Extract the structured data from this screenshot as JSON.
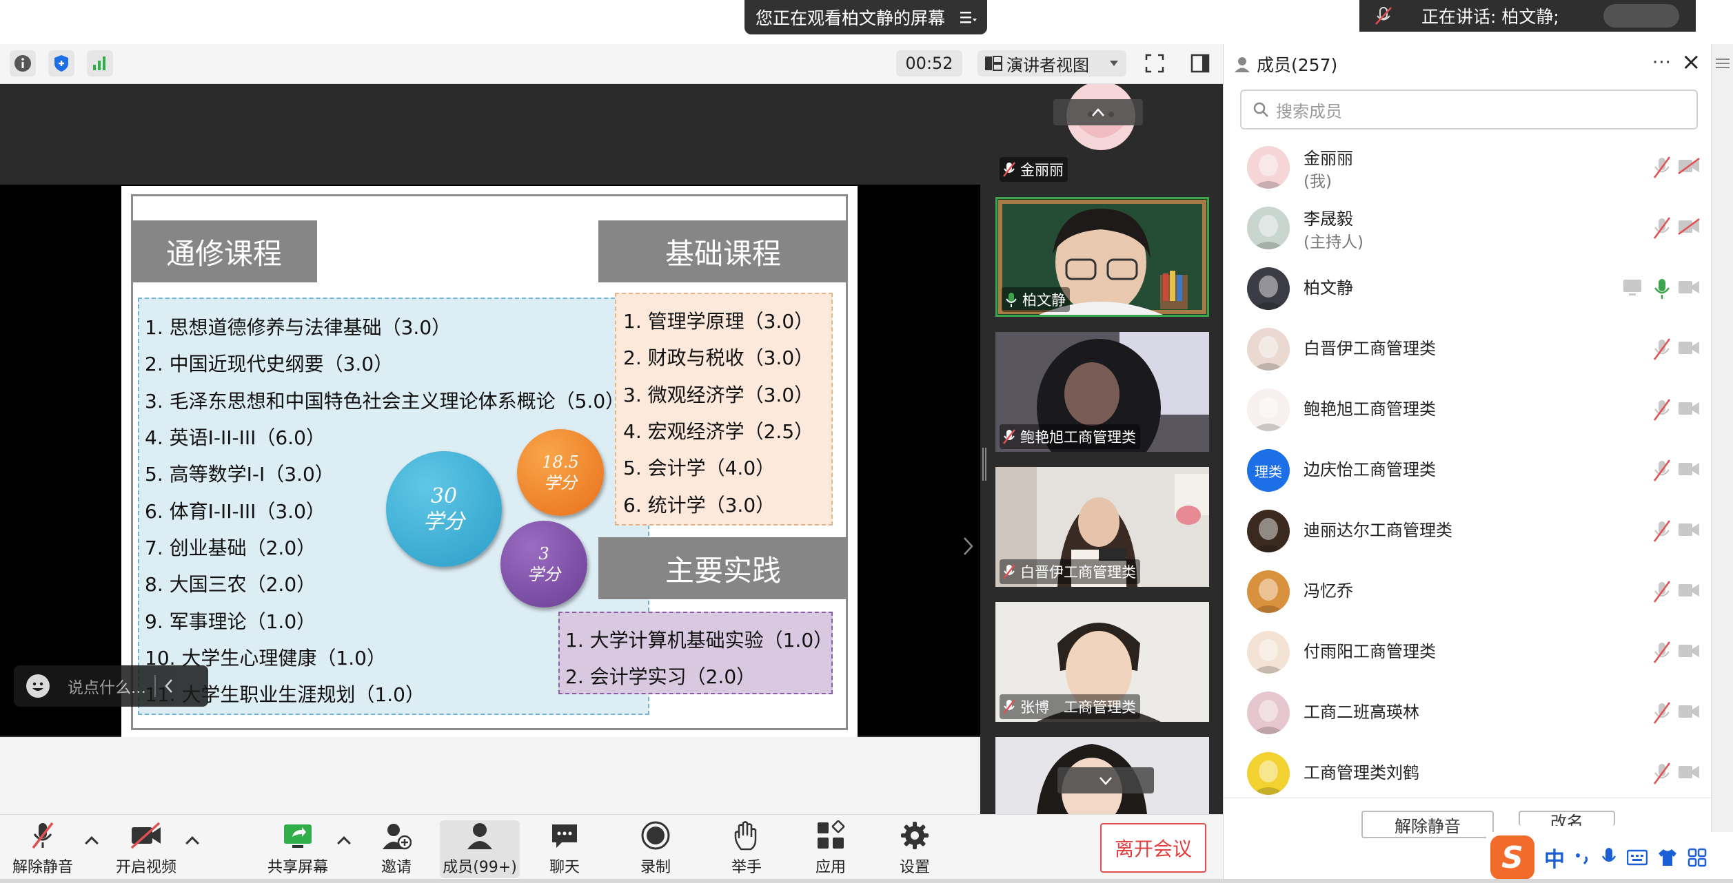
{
  "banner": {
    "text": "您正在观看柏文静的屏幕"
  },
  "speaking": {
    "text": "正在讲话: 柏文静;"
  },
  "toolbar": {
    "timer": "00:52",
    "view_label": "演讲者视图"
  },
  "slide": {
    "general": {
      "title": "通修课程",
      "credits_badge": [
        "30",
        "学分"
      ],
      "items": [
        "1. 思想道德修养与法律基础（3.0）",
        "2. 中国近现代史纲要（3.0）",
        "3. 毛泽东思想和中国特色社会主义理论体系概论（5.0）",
        "4. 英语I-II-III（6.0）",
        "5. 高等数学I-I（3.0）",
        "6. 体育I-II-III（3.0）",
        "7. 创业基础（2.0）",
        "8. 大国三农（2.0）",
        "9. 军事理论（1.0）",
        "10. 大学生心理健康（1.0）",
        "11. 大学生职业生涯规划（1.0）"
      ]
    },
    "basic": {
      "title": "基础课程",
      "credits_badge": [
        "18.5",
        "学分"
      ],
      "items": [
        "1. 管理学原理（3.0）",
        "2. 财政与税收（3.0）",
        "3. 微观经济学（3.0）",
        "4. 宏观经济学（2.5）",
        "5. 会计学（4.0）",
        "6. 统计学（3.0）"
      ]
    },
    "practice": {
      "title": "主要实践",
      "credits_badge": [
        "3",
        "学分"
      ],
      "items": [
        "1. 大学计算机基础实验（1.0）",
        "2. 会计学实习（2.0）"
      ]
    }
  },
  "chat": {
    "placeholder": "说点什么..."
  },
  "video_tiles": [
    {
      "name": "金丽丽",
      "mic": "muted"
    },
    {
      "name": "柏文静",
      "mic": "active"
    },
    {
      "name": "鲍艳旭工商管理类",
      "mic": "muted"
    },
    {
      "name": "白晋伊工商管理类",
      "mic": "muted"
    },
    {
      "name": "张博　工商管理类",
      "mic": "muted"
    }
  ],
  "members": {
    "title": "成员(257)",
    "search_placeholder": "搜索成员",
    "list": [
      {
        "name": "金丽丽",
        "sub": "(我)",
        "mic": "muted",
        "cam": "off",
        "avatar_color": "#f5d5d5"
      },
      {
        "name": "李晟毅",
        "sub": "(主持人)",
        "mic": "muted",
        "cam": "off",
        "avatar_color": "#c9d6cf"
      },
      {
        "name": "柏文静",
        "sub": "",
        "mic": "active",
        "cam": "on",
        "avatar_color": "#3b3b45"
      },
      {
        "name": "白晋伊工商管理类",
        "sub": "",
        "mic": "muted",
        "cam": "on",
        "avatar_color": "#e9d9d0"
      },
      {
        "name": "鲍艳旭工商管理类",
        "sub": "",
        "mic": "muted",
        "cam": "on",
        "avatar_color": "#f7f0ee"
      },
      {
        "name": "边庆怡工商管理类",
        "sub": "",
        "mic": "muted",
        "cam": "on",
        "avatar_color": "#1d6fe8",
        "avatar_text": "理类"
      },
      {
        "name": "迪丽达尔工商管理类",
        "sub": "",
        "mic": "muted",
        "cam": "on",
        "avatar_color": "#3a2a20"
      },
      {
        "name": "冯忆乔",
        "sub": "",
        "mic": "muted",
        "cam": "on",
        "avatar_color": "#d9913d"
      },
      {
        "name": "付雨阳工商管理类",
        "sub": "",
        "mic": "muted",
        "cam": "on",
        "avatar_color": "#f3e3d4"
      },
      {
        "name": "工商二班高瑛林",
        "sub": "",
        "mic": "muted",
        "cam": "on",
        "avatar_color": "#e7c7cf"
      },
      {
        "name": "工商管理类刘鹤",
        "sub": "",
        "mic": "muted",
        "cam": "on",
        "avatar_color": "#f2d230"
      }
    ],
    "unmute_btn": "解除静音",
    "rename_btn": "改名"
  },
  "bottom": {
    "unmute": "解除静音",
    "video": "开启视频",
    "share": "共享屏幕",
    "invite": "邀请",
    "members": "成员(99+)",
    "chat": "聊天",
    "record": "录制",
    "hand": "举手",
    "apps": "应用",
    "settings": "设置",
    "leave": "离开会议"
  },
  "ime": {
    "lang": "中"
  },
  "colors": {
    "accent": "#1d6fe8",
    "active_green": "#3aa54a",
    "leave_red": "#e04040",
    "muted_red": "#e05050"
  }
}
